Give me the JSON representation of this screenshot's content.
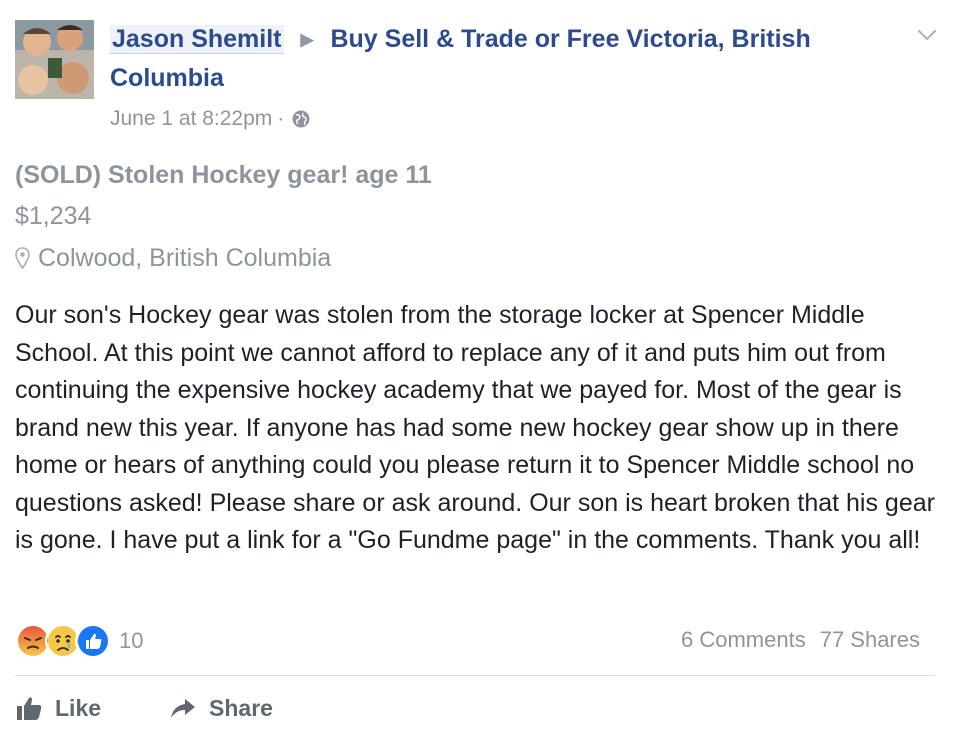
{
  "post": {
    "author": "Jason Shemilt",
    "group": "Buy Sell & Trade or Free Victoria, British Columbia",
    "timestamp": "June 1 at 8:22pm",
    "separator": "·",
    "privacy_icon": "globe-icon",
    "title": "(SOLD) Stolen Hockey gear! age 11",
    "price": "$1,234",
    "location": "Colwood, British Columbia",
    "body": "Our son's Hockey gear was stolen from the storage locker at Spencer Middle School. At this point we cannot afford to replace any of it and puts him out from continuing the expensive hockey academy that we payed for. Most of the gear is brand new this year. If anyone has had some new hockey gear show up in there home or hears of anything could you please return it to Spencer Middle school no questions asked! Please share or ask around. Our son is heart broken that his gear is gone. I have put a link for a \"Go Fundme page\" in the comments. Thank you all!"
  },
  "reactions": {
    "icons": [
      "angry-reaction-icon",
      "sad-reaction-icon",
      "like-reaction-icon"
    ],
    "count": "10",
    "comments": "6 Comments",
    "shares": "77 Shares"
  },
  "actions": {
    "like": "Like",
    "share": "Share"
  },
  "colors": {
    "link": "#2d4a8c",
    "muted": "#90949c",
    "text": "#1d2129",
    "like_blue": "#1877f2",
    "reaction_yellow": "#f7c748",
    "angry_red": "#e9573e"
  }
}
